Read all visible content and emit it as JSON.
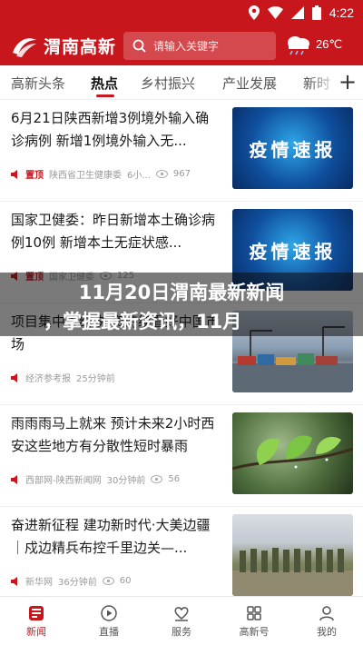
{
  "status_bar": {
    "time": "4:22"
  },
  "header": {
    "logo_text": "渭南高新",
    "search_placeholder": "请输入关键字",
    "weather_temp": "26℃"
  },
  "tabs": [
    {
      "label": "高新头条"
    },
    {
      "label": "热点"
    },
    {
      "label": "乡村振兴"
    },
    {
      "label": "产业发展"
    },
    {
      "label": "新时"
    }
  ],
  "news": [
    {
      "title": "6月21日陕西新增3例境外输入确诊病例 新增1例境外输入无...",
      "pinned": "置顶",
      "source": "陕西省卫生健康委",
      "time": "6小...",
      "views": "967",
      "thumb_text": "疫情速报"
    },
    {
      "title": "国家卫健委：昨日新增本土确诊病例10例 新增本土无症状感...",
      "pinned": "置顶",
      "source": "国家卫健委",
      "views": "125",
      "thumb_text": "疫情速报"
    },
    {
      "title": "项目集中签约 外资持续看好中国市场",
      "source": "经济参考报",
      "time": "25分钟前"
    },
    {
      "title": "雨雨雨马上就来 预计未来2小时西安这些地方有分散性短时暴雨",
      "source": "西部网-陕西新闻网",
      "time": "30分钟前",
      "views": "56"
    },
    {
      "title": "奋进新征程 建功新时代·大美边疆｜戍边精兵布控千里边关—...",
      "source": "新华网",
      "time": "36分钟前",
      "views": "60"
    }
  ],
  "overlay": {
    "line1": "11月20日渭南最新新闻",
    "line2": "，掌握最新资讯，11月"
  },
  "bottom_nav": [
    {
      "label": "新闻"
    },
    {
      "label": "直播"
    },
    {
      "label": "服务"
    },
    {
      "label": "高新号"
    },
    {
      "label": "我的"
    }
  ],
  "colors": {
    "brand_red": "#c8161d"
  }
}
